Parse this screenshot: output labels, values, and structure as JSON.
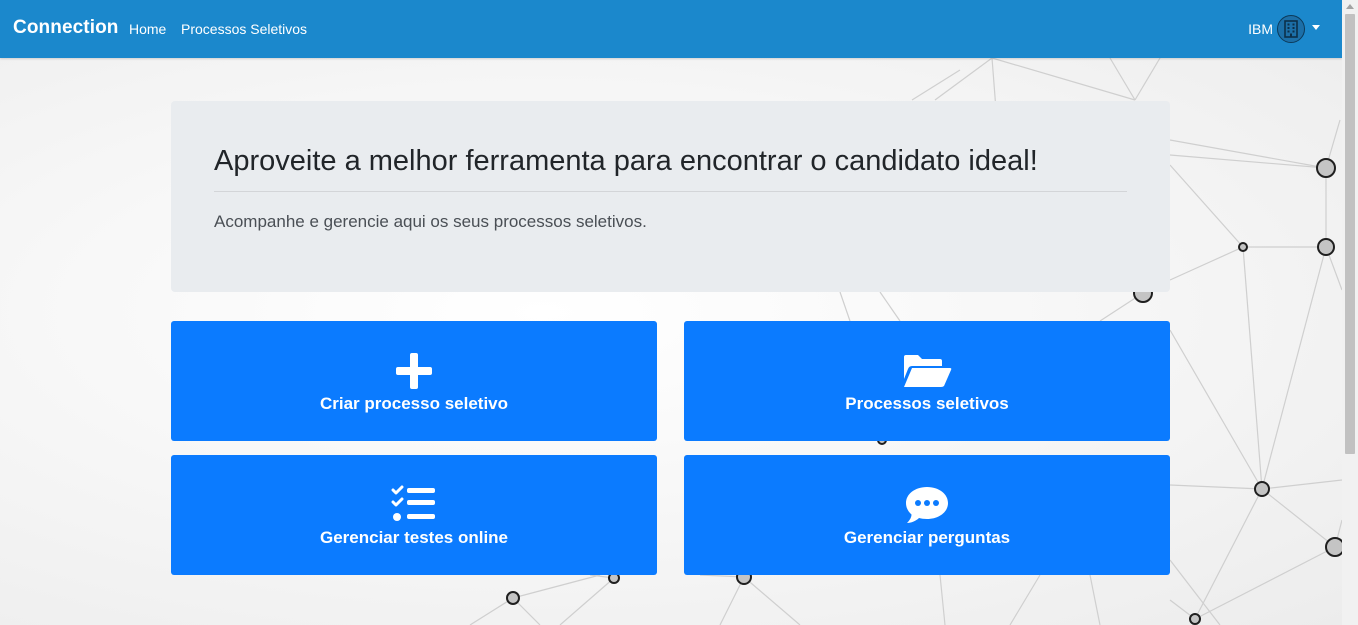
{
  "navbar": {
    "brand": "Connection",
    "links": [
      "Home",
      "Processos Seletivos"
    ],
    "user": "IBM"
  },
  "hero": {
    "title": "Aproveite a melhor ferramenta para encontrar o candidato ideal!",
    "lead": "Acompanhe e gerencie aqui os seus processos seletivos."
  },
  "tiles": [
    {
      "label": "Criar processo seletivo",
      "icon": "plus-icon"
    },
    {
      "label": "Processos seletivos",
      "icon": "folder-open-icon"
    },
    {
      "label": "Gerenciar testes online",
      "icon": "tasks-list-icon"
    },
    {
      "label": "Gerenciar perguntas",
      "icon": "comment-dots-icon"
    }
  ],
  "colors": {
    "navbar": "#1b88cc",
    "tile": "#0b7bff",
    "hero_bg": "#e9ecef"
  }
}
